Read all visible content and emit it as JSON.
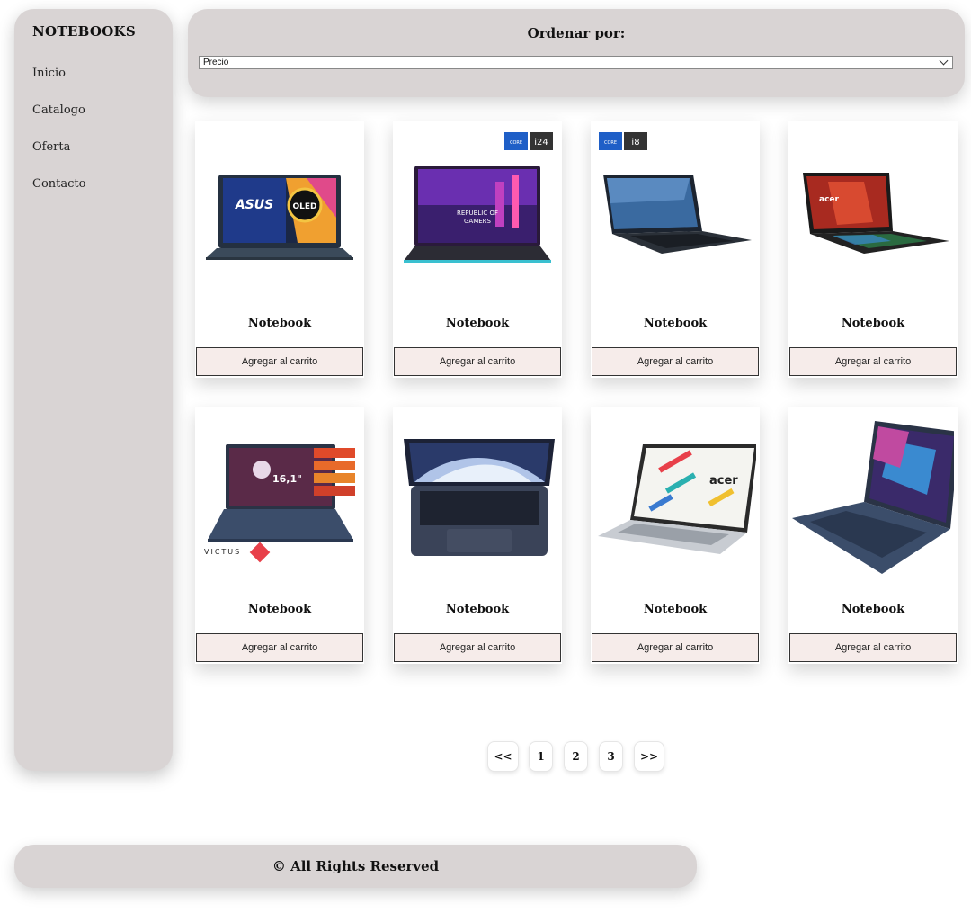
{
  "sidebar": {
    "brand": "NOTEBOOKS",
    "items": [
      {
        "label": "Inicio"
      },
      {
        "label": "Catalogo"
      },
      {
        "label": "Oferta"
      },
      {
        "label": "Contacto"
      }
    ]
  },
  "sort": {
    "title": "Ordenar por:",
    "selected": "Precio"
  },
  "products": [
    {
      "name": "Notebook",
      "button": "Agregar al carrito",
      "image_badge": "OLED",
      "brand_logo": "ASUS"
    },
    {
      "name": "Notebook",
      "button": "Agregar al carrito",
      "image_text_1": "REPUBLIC OF",
      "image_text_2": "GAMERS",
      "badge_core": "CORE",
      "badge_num": "i24"
    },
    {
      "name": "Notebook",
      "button": "Agregar al carrito",
      "badge_core": "CORE",
      "badge_num": "i8"
    },
    {
      "name": "Notebook",
      "button": "Agregar al carrito",
      "brand_logo": "acer"
    },
    {
      "name": "Notebook",
      "button": "Agregar al carrito",
      "screen_size": "16,1\"",
      "brand_logo": "VICTUS"
    },
    {
      "name": "Notebook",
      "button": "Agregar al carrito"
    },
    {
      "name": "Notebook",
      "button": "Agregar al carrito",
      "brand_logo": "acer"
    },
    {
      "name": "Notebook",
      "button": "Agregar al carrito"
    }
  ],
  "pagination": {
    "prev": "<<",
    "pages": [
      "1",
      "2",
      "3"
    ],
    "next": ">>"
  },
  "footer": {
    "text": "© All Rights Reserved"
  },
  "colors": {
    "panel": "#d9d4d4",
    "button_bg": "#f6ecea",
    "card_bg": "#ffffff"
  }
}
